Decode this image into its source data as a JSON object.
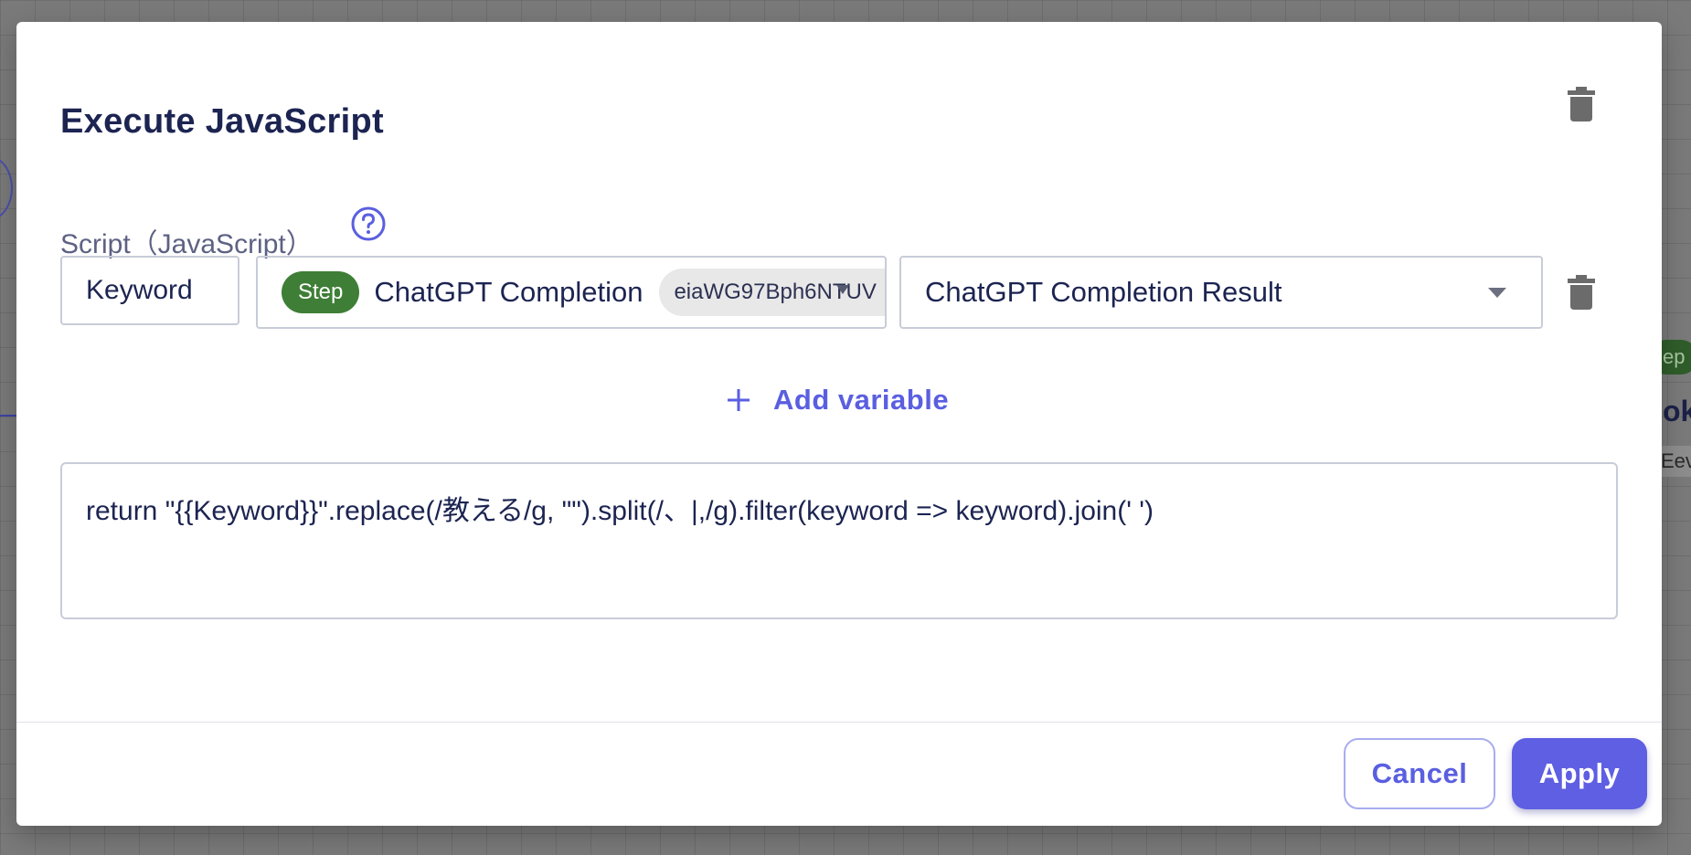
{
  "background": {
    "card_badge": "ep",
    "card_title": "ok",
    "card_chip": "Eev"
  },
  "dialog": {
    "title": "Execute JavaScript",
    "script_label": "Script（JavaScript）",
    "variable": {
      "name_value": "Keyword",
      "source": {
        "badge": "Step",
        "name": "ChatGPT Completion",
        "id": "eiaWG97Bph6NTUV"
      },
      "output_value": "ChatGPT Completion Result"
    },
    "add_variable_label": "Add variable",
    "code": "return \"{{Keyword}}\".replace(/教える/g, \"\").split(/、|,/g).filter(keyword => keyword).join(' ')",
    "cancel_label": "Cancel",
    "apply_label": "Apply"
  },
  "colors": {
    "accent": "#5e5fe3",
    "step_badge": "#3e7e36",
    "title_text": "#1c2451"
  },
  "icons": [
    "trash-icon",
    "help-circle-icon",
    "plus-icon",
    "chevron-down-icon"
  ]
}
